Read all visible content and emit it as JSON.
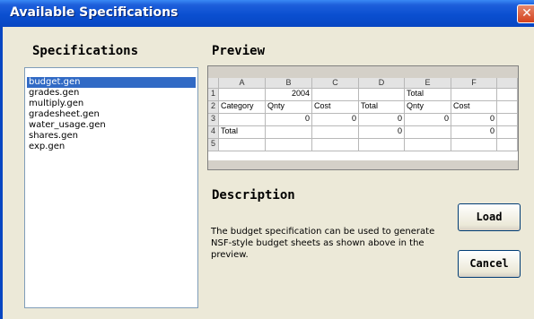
{
  "window": {
    "title": "Available Specifications",
    "close_glyph": "✕"
  },
  "specifications": {
    "heading": "Specifications",
    "items": [
      {
        "label": "budget.gen",
        "selected": true
      },
      {
        "label": "grades.gen",
        "selected": false
      },
      {
        "label": "multiply.gen",
        "selected": false
      },
      {
        "label": "gradesheet.gen",
        "selected": false
      },
      {
        "label": "water_usage.gen",
        "selected": false
      },
      {
        "label": "shares.gen",
        "selected": false
      },
      {
        "label": "exp.gen",
        "selected": false
      }
    ]
  },
  "preview": {
    "heading": "Preview",
    "columns": [
      "",
      "A",
      "B",
      "C",
      "D",
      "E",
      "F"
    ],
    "rows": [
      [
        "1",
        "",
        "2004",
        "",
        "",
        "Total",
        ""
      ],
      [
        "2",
        "Category",
        "Qnty",
        "Cost",
        "Total",
        "Qnty",
        "Cost"
      ],
      [
        "3",
        "",
        "0",
        "0",
        "0",
        "0",
        "0"
      ],
      [
        "4",
        "Total",
        "",
        "",
        "0",
        "",
        "0"
      ],
      [
        "5",
        "",
        "",
        "",
        "",
        "",
        ""
      ]
    ]
  },
  "description": {
    "heading": "Description",
    "text": "The budget specification can be used to generate NSF-style budget sheets as shown above in the preview."
  },
  "buttons": {
    "load": "Load",
    "cancel": "Cancel"
  },
  "colors": {
    "titlebar": "#0846c2",
    "selection": "#316ac5",
    "dialog_bg": "#ece9d8"
  }
}
